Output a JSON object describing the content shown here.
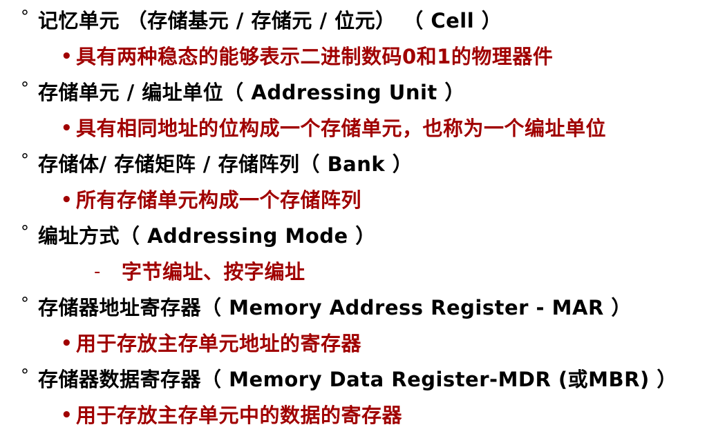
{
  "markers": {
    "term": "°",
    "bullet": "•",
    "dash": "-"
  },
  "items": [
    {
      "term": "记忆单元 （存储基元 / 存储元 / 位元） （ Cell ）",
      "description": "具有两种稳态的能够表示二进制数码0和1的物理器件",
      "description_marker": "bullet"
    },
    {
      "term": "存储单元 / 编址单位（ Addressing Unit ）",
      "description": "具有相同地址的位构成一个存储单元，也称为一个编址单位",
      "description_marker": "bullet"
    },
    {
      "term": "存储体/ 存储矩阵 / 存储阵列（ Bank ）",
      "description": "所有存储单元构成一个存储阵列",
      "description_marker": "bullet"
    },
    {
      "term": "编址方式（ Addressing Mode ）",
      "description": "字节编址、按字编址",
      "description_marker": "dash"
    },
    {
      "term": "存储器地址寄存器（ Memory Address Register - MAR ）",
      "description": "用于存放主存单元地址的寄存器",
      "description_marker": "bullet"
    },
    {
      "term": "存储器数据寄存器（  Memory Data Register-MDR (或MBR) ）",
      "description": "用于存放主存单元中的数据的寄存器",
      "description_marker": "bullet"
    }
  ]
}
